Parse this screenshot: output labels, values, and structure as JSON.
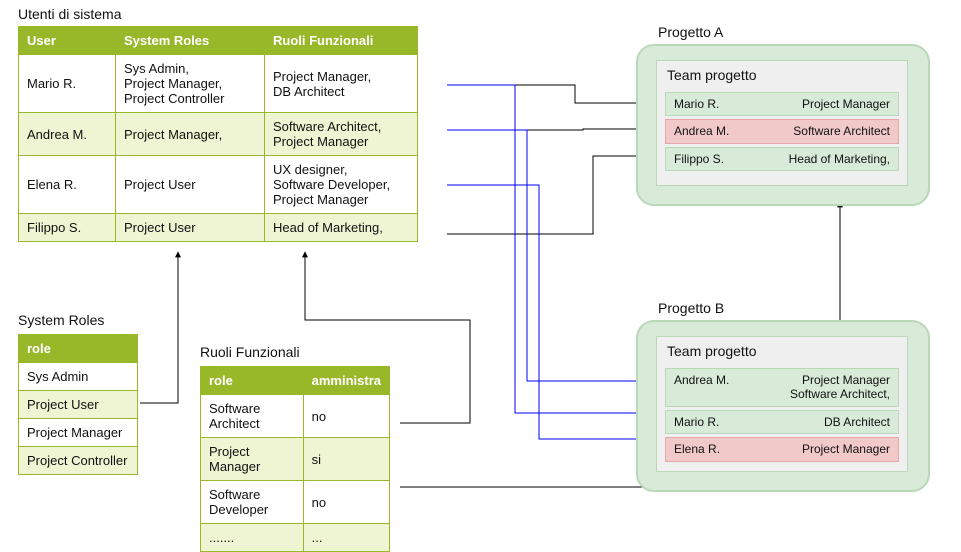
{
  "utenti": {
    "title": "Utenti di sistema",
    "headers": {
      "user": "User",
      "sys": "System Roles",
      "func": "Ruoli Funzionali"
    },
    "rows": [
      {
        "user": "Mario R.",
        "sys": "Sys Admin,\nProject Manager,\nProject Controller",
        "func": "Project Manager,\nDB Architect"
      },
      {
        "user": "Andrea M.",
        "sys": "Project Manager,",
        "func": "Software Architect,\nProject Manager"
      },
      {
        "user": "Elena R.",
        "sys": "Project User",
        "func": "UX designer,\nSoftware Developer,\nProject Manager"
      },
      {
        "user": "Filippo S.",
        "sys": "Project User",
        "func": "Head of Marketing,"
      }
    ]
  },
  "system_roles": {
    "title": "System Roles",
    "header": "role",
    "rows": [
      "Sys Admin",
      "Project User",
      "Project Manager",
      "Project Controller"
    ]
  },
  "ruoli_funzionali": {
    "title": "Ruoli Funzionali",
    "headers": {
      "role": "role",
      "amm": "amministra"
    },
    "rows": [
      {
        "role": "Software Architect",
        "amm": "no"
      },
      {
        "role": "Project Manager",
        "amm": "si"
      },
      {
        "role": "Software Developer",
        "amm": "no"
      },
      {
        "role": ".......",
        "amm": "..."
      }
    ]
  },
  "projects": {
    "a": {
      "label": "Progetto A",
      "team_title": "Team progetto",
      "members": [
        {
          "name": "Mario R.",
          "role": "Project Manager",
          "color": "g"
        },
        {
          "name": "Andrea M.",
          "role": "Software Architect",
          "color": "r"
        },
        {
          "name": "Filippo S.",
          "role": "Head of Marketing,",
          "color": "g"
        }
      ]
    },
    "b": {
      "label": "Progetto B",
      "team_title": "Team progetto",
      "members": [
        {
          "name": "Andrea M.",
          "role": "Project Manager\nSoftware Architect,",
          "color": "g"
        },
        {
          "name": "Mario R.",
          "role": "DB Architect",
          "color": "g"
        },
        {
          "name": "Elena R.",
          "role": "Project Manager",
          "color": "r"
        }
      ]
    }
  }
}
